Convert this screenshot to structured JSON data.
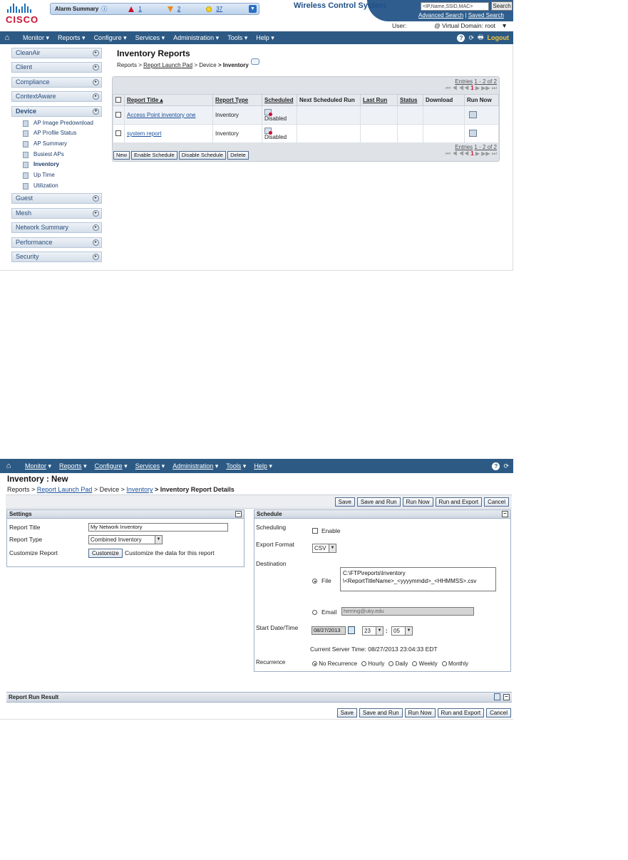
{
  "shot1": {
    "logo_text": "CISCO",
    "alarm": {
      "label": "Alarm Summary",
      "critical": "1",
      "major": "2",
      "minor": "37"
    },
    "product_title": "Wireless Control System",
    "search": {
      "placeholder": "<IP,Name,SSID,MAC>",
      "button": "Search",
      "advanced": "Advanced Search",
      "sep": "|",
      "saved": "Saved Search"
    },
    "user": {
      "label": "User:",
      "domain_label": "@ Virtual Domain:",
      "domain": "root"
    },
    "nav": [
      "Monitor ▾",
      "Reports ▾",
      "Configure ▾",
      "Services ▾",
      "Administration ▾",
      "Tools ▾",
      "Help ▾"
    ],
    "logout": "Logout",
    "sidebar_top": [
      "CleanAir",
      "Client",
      "Compliance",
      "ContextAware",
      "Device"
    ],
    "sidebar_sub": [
      "AP Image Predownload",
      "AP Profile Status",
      "AP Summary",
      "Busiest APs",
      "Inventory",
      "Up Time",
      "Utilization"
    ],
    "sidebar_bottom": [
      "Guest",
      "Mesh",
      "Network Summary",
      "Performance",
      "Security"
    ],
    "page_title": "Inventory Reports",
    "breadcrumb": {
      "p1": "Reports >",
      "p2": "Report Launch Pad",
      "p3": "> Device",
      "p4": "> Inventory"
    },
    "pager": {
      "entries": "Entries",
      "range": "1 - 2 of 2",
      "nav": "⏮ ◀ ◀◀",
      "page": "1",
      "nav2": "▶ ▶▶ ⏭"
    },
    "columns": [
      "Report Title ▴",
      "Report Type",
      "Scheduled",
      "Next Scheduled Run",
      "Last Run",
      "Status",
      "Download",
      "Run Now"
    ],
    "rows": [
      {
        "title": "Access Point inventory one",
        "type": "Inventory",
        "scheduled": "Disabled"
      },
      {
        "title": "system report",
        "type": "Inventory",
        "scheduled": "Disabled"
      }
    ],
    "buttons": [
      "New",
      "Enable Schedule",
      "Disable Schedule",
      "Delete"
    ]
  },
  "shot2": {
    "nav": [
      "Monitor",
      "Reports",
      "Configure",
      "Services",
      "Administration",
      "Tools",
      "Help"
    ],
    "title": "Inventory : New",
    "breadcrumb": {
      "p1": "Reports >",
      "p2": "Report Launch Pad",
      "p3": "> Device >",
      "p4": "Inventory",
      "p5": "> Inventory Report Details"
    },
    "top_buttons": [
      "Save",
      "Save and Run",
      "Run Now",
      "Run and Export",
      "Cancel"
    ],
    "settings": {
      "header": "Settings",
      "report_title_label": "Report Title",
      "report_title_value": "My Network Inventory",
      "report_type_label": "Report Type",
      "report_type_value": "Combined Inventory",
      "customize_label": "Customize Report",
      "customize_button": "Customize",
      "customize_text": "Customize the data for this report"
    },
    "schedule": {
      "header": "Schedule",
      "scheduling_label": "Scheduling",
      "enable_label": "Enable",
      "export_label": "Export Format",
      "export_value": "CSV",
      "destination_label": "Destination",
      "file_label": "File",
      "file_path": "C:\\FTP\\reports\\Inventory\n\\<ReportTitleName>_<yyyymmdd>_<HHMMSS>.csv",
      "email_label": "Email",
      "email_value": "herring@uky.edu",
      "start_label": "Start Date/Time",
      "date_value": "08/27/2013",
      "hour_value": "23",
      "colon": ":",
      "minute_value": "05",
      "server_time": "Current Server Time: 08/27/2013 23:04:33 EDT",
      "recurrence_label": "Recurrence",
      "recurrence_options": [
        "No Recurrence",
        "Hourly",
        "Daily",
        "Weekly",
        "Monthly"
      ]
    },
    "result_header": "Report Run Result",
    "bottom_buttons": [
      "Save",
      "Save and Run",
      "Run Now",
      "Run and Export",
      "Cancel"
    ]
  }
}
